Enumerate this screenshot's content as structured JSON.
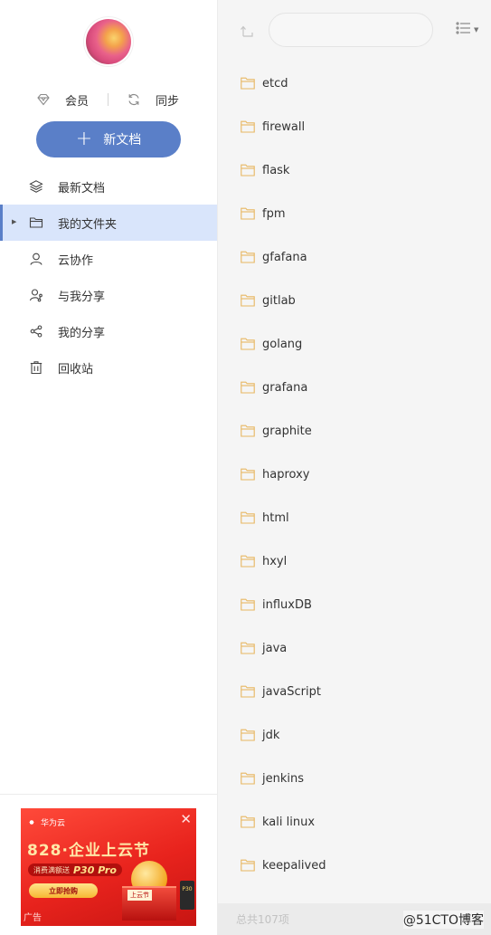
{
  "sidebar": {
    "member": {
      "vip_label": "会员",
      "sync_label": "同步"
    },
    "new_doc_label": "新文档",
    "nav": [
      {
        "label": "最新文档",
        "icon": "layers-icon"
      },
      {
        "label": "我的文件夹",
        "icon": "folder-open-icon",
        "active": true
      },
      {
        "label": "云协作",
        "icon": "user-icon"
      },
      {
        "label": "与我分享",
        "icon": "shared-with-me-icon"
      },
      {
        "label": "我的分享",
        "icon": "share-icon"
      },
      {
        "label": "回收站",
        "icon": "trash-icon"
      }
    ],
    "ad": {
      "brand": "华为云",
      "headline": "828·企业上云节",
      "promo_prefix": "消费满额送",
      "promo_product": "P30 Pro",
      "cta": "立即抢购",
      "label": "广告",
      "festival_tag": "上云节",
      "phone_tag": "P30",
      "close": "✕"
    }
  },
  "toolbar": {
    "search_placeholder": "",
    "search_value": ""
  },
  "folders": [
    "etcd",
    "firewall",
    "flask",
    "fpm",
    "gfafana",
    "gitlab",
    "golang",
    "grafana",
    "graphite",
    "haproxy",
    "html",
    "hxyl",
    "influxDB",
    "java",
    "javaScript",
    "jdk",
    "jenkins",
    "kali linux",
    "keepalived",
    ""
  ],
  "status": {
    "count_text": "总共107项",
    "watermark": "@51CTO博客"
  },
  "colors": {
    "accent": "#5a7fc8",
    "active_bg": "#d9e5fb",
    "folder_icon": "#e8b761"
  }
}
